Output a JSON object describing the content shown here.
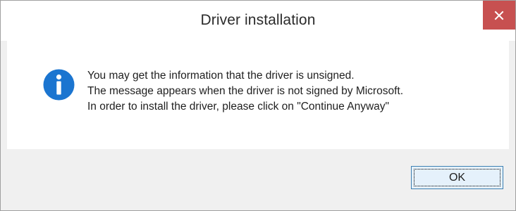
{
  "window": {
    "title": "Driver installation",
    "close_glyph": "✕"
  },
  "icon": {
    "name": "info-icon",
    "color": "#1b75d0"
  },
  "message": {
    "lines": [
      "You may get the information that the driver is unsigned.",
      "The message appears when the driver is not signed by Microsoft.",
      "In order to install the driver, please click on \"Continue Anyway\""
    ]
  },
  "buttons": {
    "ok_label": "OK"
  },
  "colors": {
    "close_button": "#c75050",
    "ok_button_border": "#3c7fb1",
    "ok_button_fill": "#e5f1fb"
  }
}
